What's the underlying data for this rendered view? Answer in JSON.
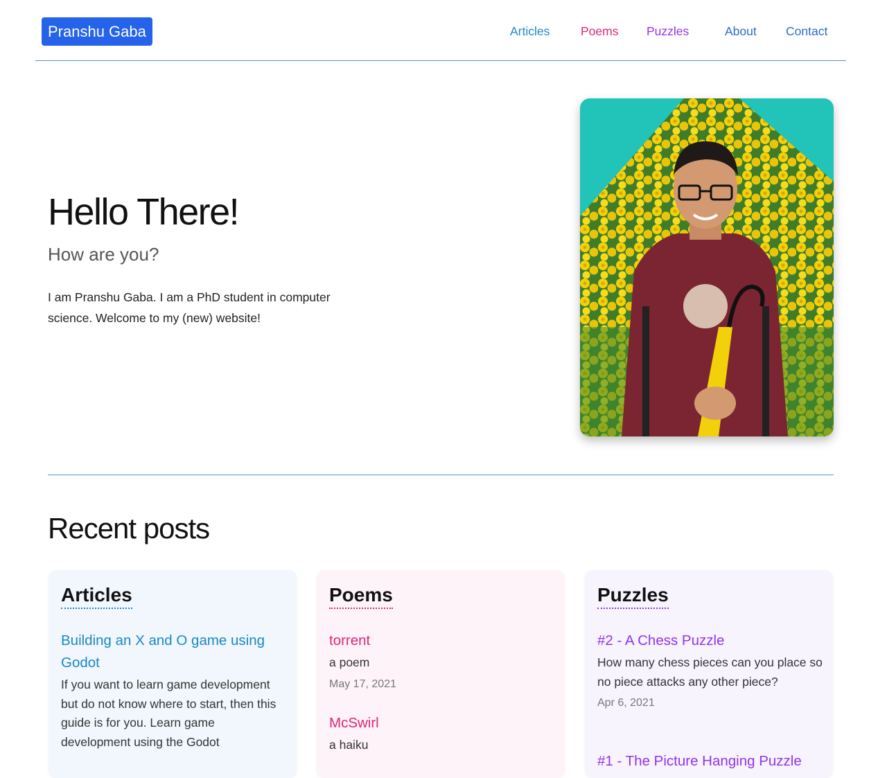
{
  "header": {
    "brand": "Pranshu Gaba",
    "nav": [
      "Articles",
      "Poems",
      "Puzzles",
      "About",
      "Contact"
    ]
  },
  "hero": {
    "title": "Hello There!",
    "subtitle": "How are you?",
    "intro": "I am Pranshu Gaba. I am a PhD student in computer science. Welcome to my (new) website!"
  },
  "recent": {
    "title": "Recent posts",
    "articles": {
      "heading": "Articles",
      "posts": [
        {
          "title": "Building an X and O game using Godot",
          "desc": "If you want to learn game development but do not know where to start, then this guide is for you. Learn game development using the Godot"
        }
      ]
    },
    "poems": {
      "heading": "Poems",
      "posts": [
        {
          "title": "torrent",
          "desc": "a poem",
          "date": "May 17, 2021"
        },
        {
          "title": "McSwirl",
          "desc": "a haiku"
        }
      ]
    },
    "puzzles": {
      "heading": "Puzzles",
      "posts": [
        {
          "title": "#2 - A Chess Puzzle",
          "desc": "How many chess pieces can you place so no piece attacks any other piece?",
          "date": "Apr 6, 2021"
        },
        {
          "title": "#1 - The Picture Hanging Puzzle"
        }
      ]
    }
  },
  "colors": {
    "brand_bg": "#2563eb",
    "articles": "#1e88c8",
    "poems": "#db2777",
    "puzzles": "#9333ea",
    "divider": "#5b8fc9"
  },
  "icons": {
    "profile_photo": "profile-photo"
  }
}
